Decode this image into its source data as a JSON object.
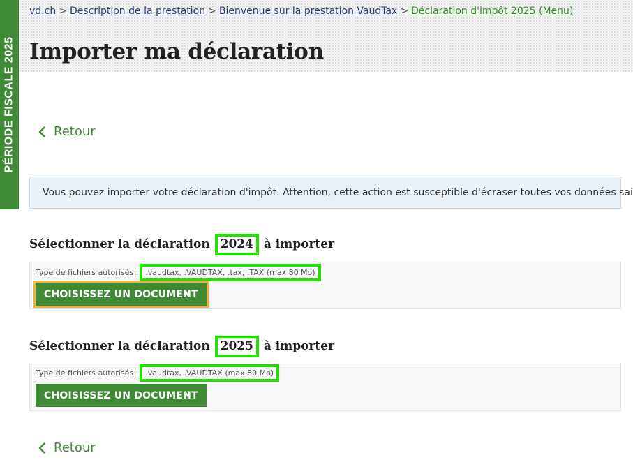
{
  "side_tab": {
    "label": "PÉRIODE FISCALE 2025"
  },
  "breadcrumb": {
    "items": [
      "vd.ch",
      "Description de la prestation",
      "Bienvenue sur la prestation VaudTax",
      "Déclaration d'impôt 2025 (Menu)"
    ],
    "separator": ">"
  },
  "page": {
    "title": "Importer ma déclaration"
  },
  "back_link": {
    "label": "Retour"
  },
  "info": {
    "text": "Vous pouvez importer votre déclaration d'impôt. Attention, cette action est susceptible d'écraser toutes vos données saisies."
  },
  "sections": [
    {
      "title_before": "Sélectionner la déclaration",
      "year": "2024",
      "title_after": "à importer",
      "file_types_label": "Type de fichiers autorisés :",
      "file_types": ".vaudtax, .VAUDTAX, .tax, .TAX (max 80 Mo)",
      "button_label": "CHOISISSEZ UN DOCUMENT"
    },
    {
      "title_before": "Sélectionner la déclaration",
      "year": "2025",
      "title_after": "à importer",
      "file_types_label": "Type de fichiers autorisés :",
      "file_types": ".vaudtax, .VAUDTAX (max 80 Mo)",
      "button_label": "CHOISISSEZ UN DOCUMENT"
    }
  ],
  "colors": {
    "brand_green": "#3f8a34",
    "link_blue": "#2d3e72",
    "highlight": "#22e000",
    "focus_outline": "#f0b23c"
  },
  "icons": {
    "back": "chevron-left-icon"
  }
}
